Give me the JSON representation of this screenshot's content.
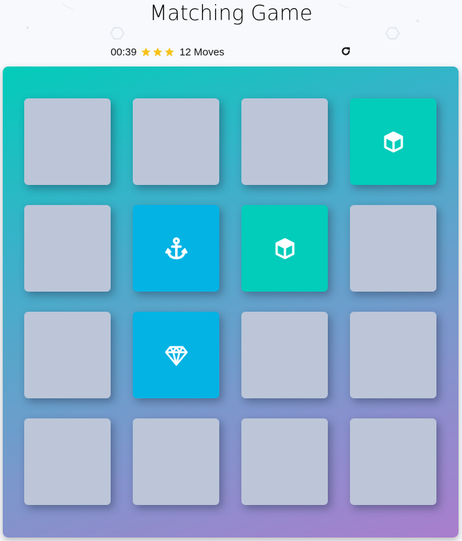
{
  "title": "Matching Game",
  "score": {
    "timer": "00:39",
    "stars": [
      "star-icon",
      "star-icon",
      "star-icon"
    ],
    "star_color": "#f7c21a",
    "moves_count": "12",
    "moves_label": "Moves",
    "restart_icon": "restart-icon"
  },
  "colors": {
    "card_hidden": "#bcc6d8",
    "card_match": "#02ccba",
    "card_open": "#02b3e4",
    "deck_gradient_start": "#02ccba",
    "deck_gradient_end": "#aa7ecd"
  },
  "cards": [
    {
      "state": "hidden",
      "icon": null
    },
    {
      "state": "hidden",
      "icon": null
    },
    {
      "state": "hidden",
      "icon": null
    },
    {
      "state": "match",
      "icon": "cube-icon"
    },
    {
      "state": "hidden",
      "icon": null
    },
    {
      "state": "open",
      "icon": "anchor-icon"
    },
    {
      "state": "match",
      "icon": "cube-icon"
    },
    {
      "state": "hidden",
      "icon": null
    },
    {
      "state": "hidden",
      "icon": null
    },
    {
      "state": "open",
      "icon": "diamond-icon"
    },
    {
      "state": "hidden",
      "icon": null
    },
    {
      "state": "hidden",
      "icon": null
    },
    {
      "state": "hidden",
      "icon": null
    },
    {
      "state": "hidden",
      "icon": null
    },
    {
      "state": "hidden",
      "icon": null
    },
    {
      "state": "hidden",
      "icon": null
    }
  ]
}
